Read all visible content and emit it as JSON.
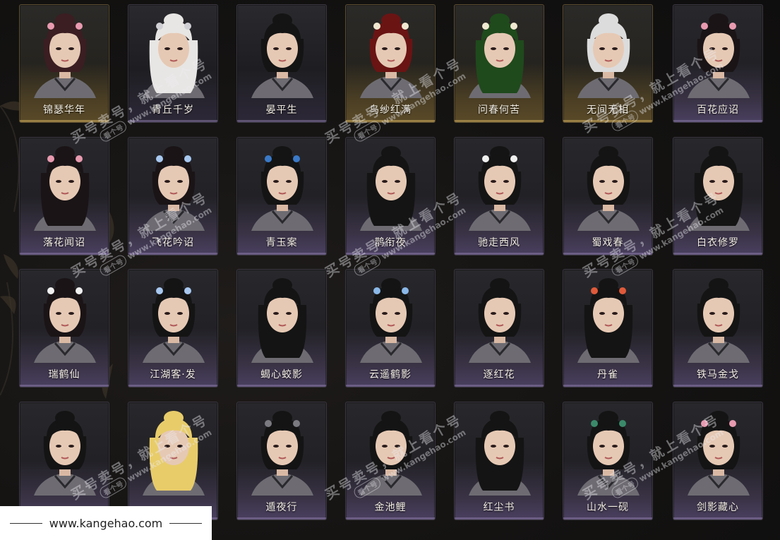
{
  "hairstyles": [
    {
      "name": "锦瑟华年",
      "tier": "gold",
      "hair": "#3a1e22",
      "acc": "#e89ab0"
    },
    {
      "name": "青丘千岁",
      "tier": "plain",
      "hair": "#e8e6e4",
      "acc": "#cfcfd4"
    },
    {
      "name": "晏平生",
      "tier": "plain",
      "hair": "#141414",
      "acc": ""
    },
    {
      "name": "乌纱红满",
      "tier": "gold",
      "hair": "#6a1414",
      "acc": "#f0e8d0"
    },
    {
      "name": "问春何苦",
      "tier": "gold",
      "hair": "#1f4a1c",
      "acc": "#f0e8d0"
    },
    {
      "name": "无间无相",
      "tier": "gold",
      "hair": "#dcdcdc",
      "acc": ""
    },
    {
      "name": "百花应诏",
      "tier": "purple",
      "hair": "#1a1416",
      "acc": "#e89ab0"
    },
    {
      "name": "落花闻诏",
      "tier": "purple",
      "hair": "#1a1416",
      "acc": "#e89ab0"
    },
    {
      "name": "飞花吟诏",
      "tier": "purple",
      "hair": "#1a1416",
      "acc": "#a8c8f0"
    },
    {
      "name": "青玉案",
      "tier": "purple",
      "hair": "#141414",
      "acc": "#3a7ac8"
    },
    {
      "name": "鹊衔夜",
      "tier": "purple",
      "hair": "#141414",
      "acc": ""
    },
    {
      "name": "驰走西风",
      "tier": "purple",
      "hair": "#141414",
      "acc": "#f0f0f0"
    },
    {
      "name": "蜀戏春",
      "tier": "purple",
      "hair": "#141414",
      "acc": ""
    },
    {
      "name": "白衣修罗",
      "tier": "purple",
      "hair": "#141414",
      "acc": ""
    },
    {
      "name": "瑞鹤仙",
      "tier": "purple",
      "hair": "#1a1416",
      "acc": "#f0f0f0"
    },
    {
      "name": "江湖客·发",
      "tier": "purple",
      "hair": "#141414",
      "acc": "#a8c8f0"
    },
    {
      "name": "蝎心蛟影",
      "tier": "purple",
      "hair": "#141414",
      "acc": ""
    },
    {
      "name": "云遥鹤影",
      "tier": "purple",
      "hair": "#141414",
      "acc": "#8ab8e8"
    },
    {
      "name": "逐红花",
      "tier": "purple",
      "hair": "#141414",
      "acc": ""
    },
    {
      "name": "丹雀",
      "tier": "purple",
      "hair": "#141414",
      "acc": "#e05a3a"
    },
    {
      "name": "铁马金戈",
      "tier": "purple",
      "hair": "#141414",
      "acc": ""
    },
    {
      "name": "…",
      "tier": "purple",
      "hair": "#141414",
      "acc": ""
    },
    {
      "name": "…",
      "tier": "purple",
      "hair": "#e8cc6a",
      "acc": ""
    },
    {
      "name": "遁夜行",
      "tier": "purple",
      "hair": "#141414",
      "acc": "#7a7a80"
    },
    {
      "name": "金池鲤",
      "tier": "purple",
      "hair": "#141414",
      "acc": ""
    },
    {
      "name": "红尘书",
      "tier": "purple",
      "hair": "#141414",
      "acc": ""
    },
    {
      "name": "山水一砚",
      "tier": "purple",
      "hair": "#141414",
      "acc": "#3a8a6a"
    },
    {
      "name": "剑影藏心",
      "tier": "purple",
      "hair": "#141414",
      "acc": "#e89ab0"
    }
  ],
  "watermark": {
    "text": "买号卖号，就上看个号",
    "url": "www.kangehao.com",
    "badge": "看个号"
  },
  "footer": {
    "url": "www.kangehao.com"
  }
}
